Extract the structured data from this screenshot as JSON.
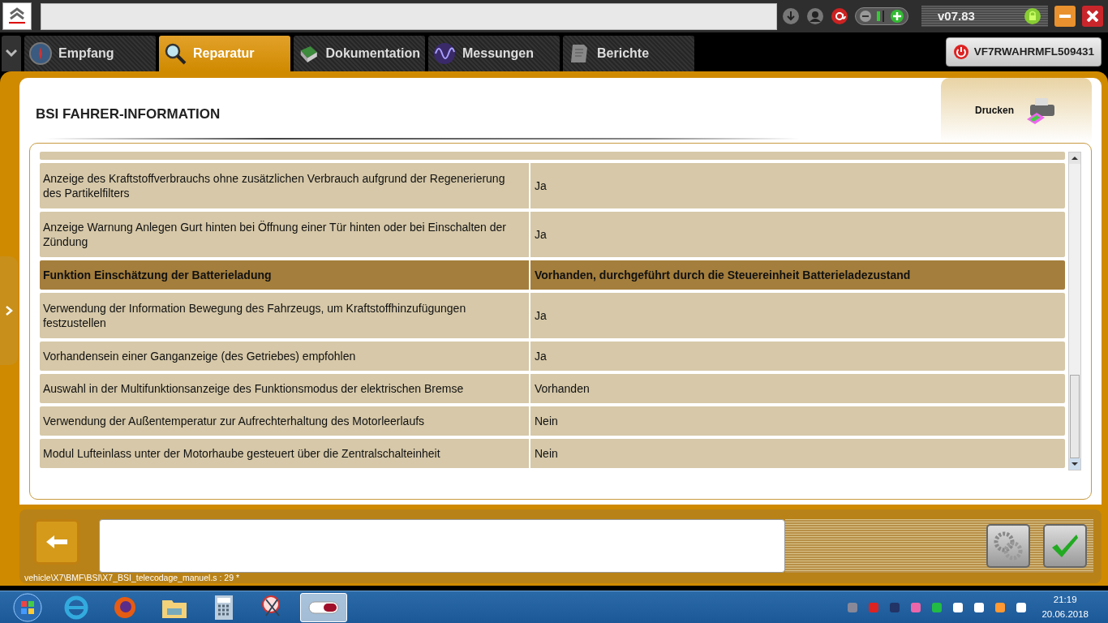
{
  "top_bar": {
    "version": "v07.83"
  },
  "tabs": [
    {
      "label": "Empfang",
      "selected": false,
      "kind": "compass"
    },
    {
      "label": "Reparatur",
      "selected": true,
      "kind": "magnifier"
    },
    {
      "label": "Dokumentation",
      "selected": false,
      "kind": "book"
    },
    {
      "label": "Messungen",
      "selected": false,
      "kind": "wave"
    },
    {
      "label": "Berichte",
      "selected": false,
      "kind": "document"
    }
  ],
  "vin_button": {
    "label": "VF7RWAHRMFL509431"
  },
  "page": {
    "title": "BSI  FAHRER-INFORMATION",
    "print_button": "Drucken"
  },
  "table": {
    "rows": [
      {
        "label": "Anzeige des Kraftstoffverbrauchs ohne zusätzlichen Verbrauch aufgrund der Regenerierung des Partikelfilters",
        "value": "Ja",
        "selected": false
      },
      {
        "label": "Anzeige Warnung Anlegen Gurt hinten bei Öffnung einer Tür hinten oder bei Einschalten der Zündung",
        "value": "Ja",
        "selected": false
      },
      {
        "label": "Funktion Einschätzung der Batterieladung",
        "value": "Vorhanden, durchgeführt durch die Steuereinheit Batterieladezustand",
        "selected": true
      },
      {
        "label": "Verwendung der Information Bewegung des Fahrzeugs, um Kraftstoffhinzufügungen festzustellen",
        "value": "Ja",
        "selected": false
      },
      {
        "label": "Vorhandensein einer Ganganzeige (des Getriebes) empfohlen",
        "value": "Ja",
        "selected": false
      },
      {
        "label": "Auswahl in der Multifunktionsanzeige des Funktionsmodus der elektrischen Bremse",
        "value": "Vorhanden",
        "selected": false
      },
      {
        "label": "Verwendung der Außentemperatur zur Aufrechterhaltung des Motorleerlaufs",
        "value": "Nein",
        "selected": false
      },
      {
        "label": "Modul Lufteinlass unter der Motorhaube gesteuert über die Zentralschalteinheit",
        "value": "Nein",
        "selected": false
      }
    ]
  },
  "status_path": "vehicle\\X7\\BMF\\BSI\\X7_BSI_telecodage_manuel.s : 29 *",
  "taskbar": {
    "time": "21:19",
    "date": "20.06.2018"
  }
}
